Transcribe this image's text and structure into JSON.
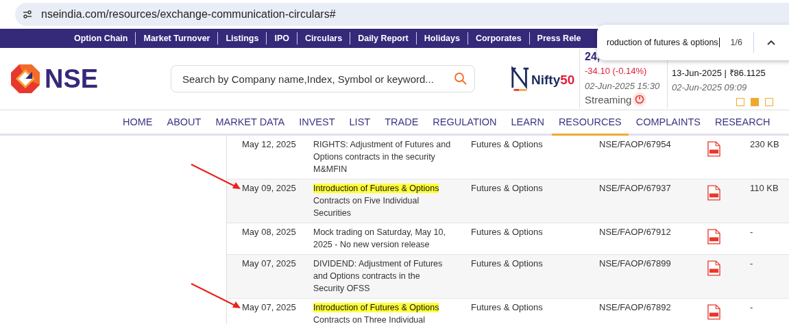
{
  "browser": {
    "url": "nseindia.com/resources/exchange-communication-circulars#"
  },
  "top_links": [
    "Option Chain",
    "Market Turnover",
    "Listings",
    "IPO",
    "Circulars",
    "Daily Report",
    "Holidays",
    "Corporates",
    "Press Rele"
  ],
  "find_bar": {
    "query": "roduction of futures & options",
    "count": "1/6"
  },
  "search": {
    "placeholder": "Search by Company name,Index, Symbol or keyword..."
  },
  "logo": {
    "text": "NSE"
  },
  "nifty": {
    "logo_text": "Nifty",
    "logo_number": "50",
    "value": "24,",
    "change": "-34.10 (-0.14%)",
    "time": "02-Jun-2025 15:30",
    "status": "Streaming"
  },
  "currency": {
    "value": "13-Jun-2025 | ₹86.1125",
    "time": "02-Jun-2025 09:09"
  },
  "carousel": [
    {
      "selected": false
    },
    {
      "selected": true
    },
    {
      "selected": false
    }
  ],
  "nav": [
    {
      "label": "HOME",
      "selected": false
    },
    {
      "label": "ABOUT",
      "selected": false
    },
    {
      "label": "MARKET DATA",
      "selected": false
    },
    {
      "label": "INVEST",
      "selected": false
    },
    {
      "label": "LIST",
      "selected": false
    },
    {
      "label": "TRADE",
      "selected": false
    },
    {
      "label": "REGULATION",
      "selected": false
    },
    {
      "label": "LEARN",
      "selected": false
    },
    {
      "label": "RESOURCES",
      "selected": true
    },
    {
      "label": "COMPLAINTS",
      "selected": false
    },
    {
      "label": "RESEARCH",
      "selected": false
    }
  ],
  "rows": [
    {
      "date": "May 12, 2025",
      "match": "",
      "subject": "RIGHTS: Adjustment of Futures and Options contracts in the security M&MFIN",
      "department": "Futures & Options",
      "circular_no": "NSE/FAOP/67954",
      "size": "230 KB",
      "arrow": false
    },
    {
      "date": "May 09, 2025",
      "match": "Introduction of Futures & Options",
      "subject": "Contracts on Five Individual Securities",
      "department": "Futures & Options",
      "circular_no": "NSE/FAOP/67937",
      "size": "110 KB",
      "arrow": true
    },
    {
      "date": "May 08, 2025",
      "match": "",
      "subject": "Mock trading on Saturday, May 10, 2025 - No new version release",
      "department": "Futures & Options",
      "circular_no": "NSE/FAOP/67912",
      "size": "-",
      "arrow": false
    },
    {
      "date": "May 07, 2025",
      "match": "",
      "subject": "DIVIDEND: Adjustment of Futures and Options contracts in the Security OFSS",
      "department": "Futures & Options",
      "circular_no": "NSE/FAOP/67899",
      "size": "-",
      "arrow": false
    },
    {
      "date": "May 07, 2025",
      "match": "Introduction of Futures & Options",
      "subject": "Contracts on Three Individual",
      "department": "Futures & Options",
      "circular_no": "NSE/FAOP/67892",
      "size": "-",
      "arrow": true
    }
  ]
}
